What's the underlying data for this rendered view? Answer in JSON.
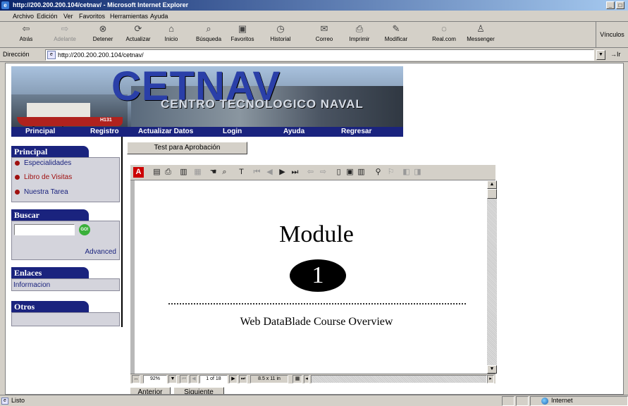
{
  "window": {
    "title": "http://200.200.200.104/cetnav/ - Microsoft Internet Explorer",
    "minimize": "_",
    "maximize": "□"
  },
  "menu": [
    "Archivo",
    "Edición",
    "Ver",
    "Favoritos",
    "Herramientas",
    "Ayuda"
  ],
  "toolbar": {
    "back": "Atrás",
    "forward": "Adelante",
    "stop": "Detener",
    "refresh": "Actualizar",
    "home": "Inicio",
    "search": "Búsqueda",
    "favorites": "Favoritos",
    "history": "Historial",
    "mail": "Correo",
    "print": "Imprimir",
    "edit": "Modificar",
    "realcom": "Real.com",
    "messenger": "Messenger",
    "links": "Vínculos"
  },
  "address": {
    "label": "Dirección",
    "url": "http://200.200.200.104/cetnav/",
    "go": "Ir"
  },
  "banner": {
    "logo": "CETNAV",
    "subtitle": "CENTRO TECNOLOGICO NAVAL",
    "hull_number": "H131"
  },
  "nav": [
    "Principal",
    "Registro",
    "Actualizar Datos",
    "Login",
    "Ayuda",
    "Regresar"
  ],
  "sidebar": {
    "principal_title": "Principal",
    "principal_items": [
      "Especialidades",
      "Libro de Visitas",
      "Nuestra Tarea"
    ],
    "buscar_title": "Buscar",
    "search_value": "",
    "go_label": "GO!",
    "advanced": "Advanced",
    "enlaces_title": "Enlaces",
    "enlaces_items": [
      "Informacion"
    ],
    "otros_title": "Otros"
  },
  "main": {
    "test_button": "Test para Aprobación",
    "pdf": {
      "title": "Module",
      "number": "1",
      "subtitle": "Web DataBlade Course Overview",
      "zoom": "92%",
      "page": "1 of 18",
      "page_size": "8.5 x 11 in"
    },
    "prev_button": "Anterior",
    "next_button": "Siguiente"
  },
  "status": {
    "text": "Listo",
    "zone": "Internet"
  },
  "colors": {
    "nav_blue": "#1a237e",
    "logo_blue": "#2a3fa8",
    "bullet_red": "#a01010",
    "title_bar": "#0a246a"
  }
}
